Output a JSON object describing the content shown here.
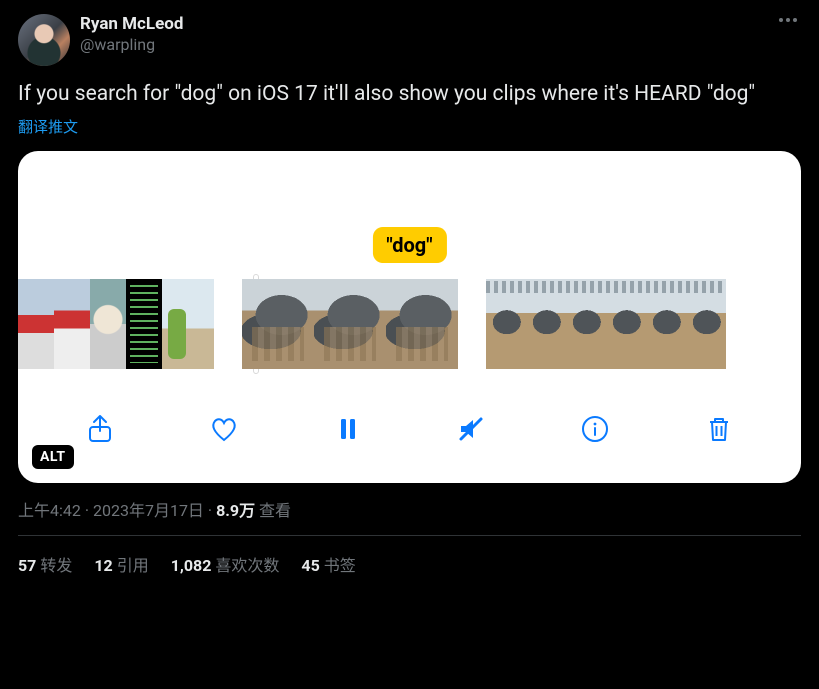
{
  "author": {
    "display_name": "Ryan McLeod",
    "handle": "@warpling"
  },
  "tweet_text": "If you search for \"dog\" on iOS 17 it'll also show you clips where it's HEARD \"dog\"",
  "translate_label": "翻译推文",
  "media": {
    "transcript_badge": "\"dog\"",
    "alt_badge": "ALT"
  },
  "meta": {
    "time": "上午4:42",
    "date": "2023年7月17日",
    "separator": " · ",
    "views_count": "8.9万",
    "views_label": " 查看"
  },
  "stats": {
    "retweets": {
      "count": "57",
      "label": "转发"
    },
    "quotes": {
      "count": "12",
      "label": "引用"
    },
    "likes": {
      "count": "1,082",
      "label": "喜欢次数"
    },
    "bookmarks": {
      "count": "45",
      "label": "书签"
    }
  }
}
